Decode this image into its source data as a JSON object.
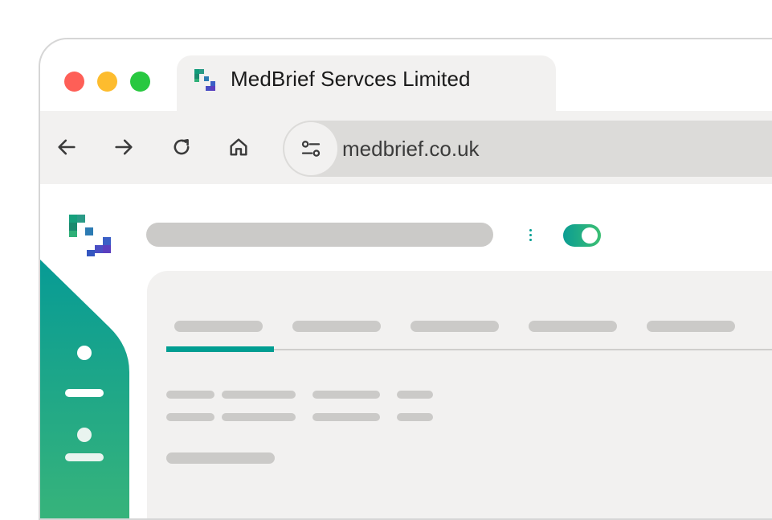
{
  "browser": {
    "tab_title": "MedBrief Servces Limited",
    "url": "medbrief.co.uk"
  },
  "colors": {
    "brand_teal": "#009e92",
    "brand_green": "#3cbf73",
    "brand_blue": "#2f4fc0",
    "brand_purple": "#5b3fbf"
  },
  "icons": {
    "back": "arrow-left-icon",
    "forward": "arrow-right-icon",
    "reload": "reload-icon",
    "home": "home-icon",
    "site_info": "tune-icon",
    "sidebar": [
      "dot-icon",
      "dash-icon",
      "user-icon"
    ]
  },
  "app": {
    "toggle_on": true,
    "active_tab_index": 0
  }
}
